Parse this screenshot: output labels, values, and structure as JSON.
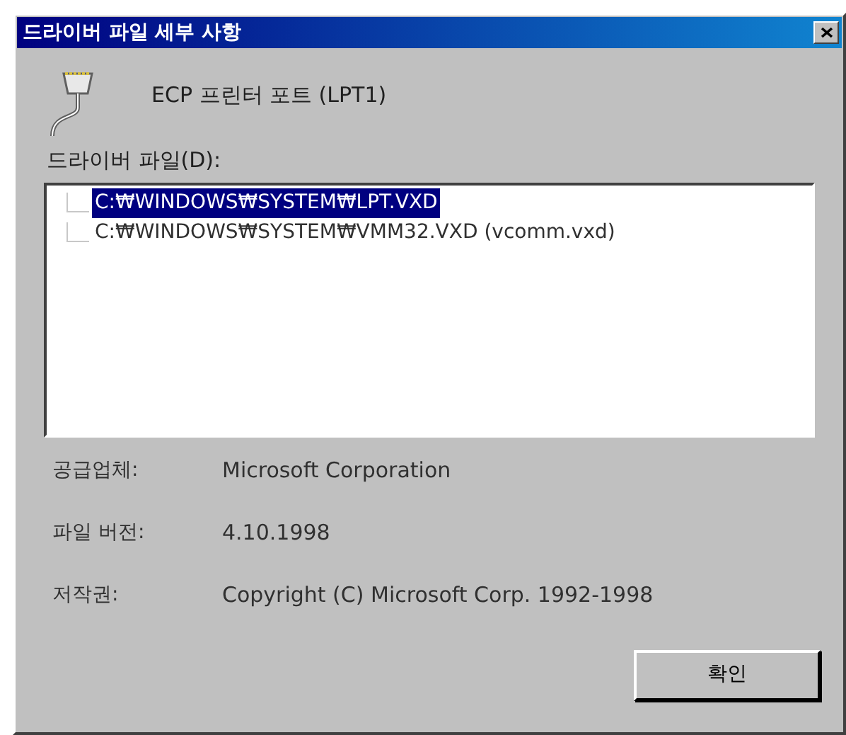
{
  "window": {
    "title": "드라이버 파일 세부 사항"
  },
  "device": {
    "name": "ECP 프린터 포트 (LPT1)"
  },
  "files_label": "드라이버 파일(D):",
  "files": [
    {
      "path": "C:₩WINDOWS₩SYSTEM₩LPT.VXD",
      "selected": true
    },
    {
      "path": "C:₩WINDOWS₩SYSTEM₩VMM32.VXD (vcomm.vxd)",
      "selected": false
    }
  ],
  "details": [
    {
      "label": "공급업체:",
      "value": "Microsoft Corporation"
    },
    {
      "label": "파일 버전:",
      "value": "4.10.1998"
    },
    {
      "label": "저작권:",
      "value": "Copyright (C) Microsoft Corp. 1992-1998"
    }
  ],
  "buttons": [
    "확인"
  ]
}
